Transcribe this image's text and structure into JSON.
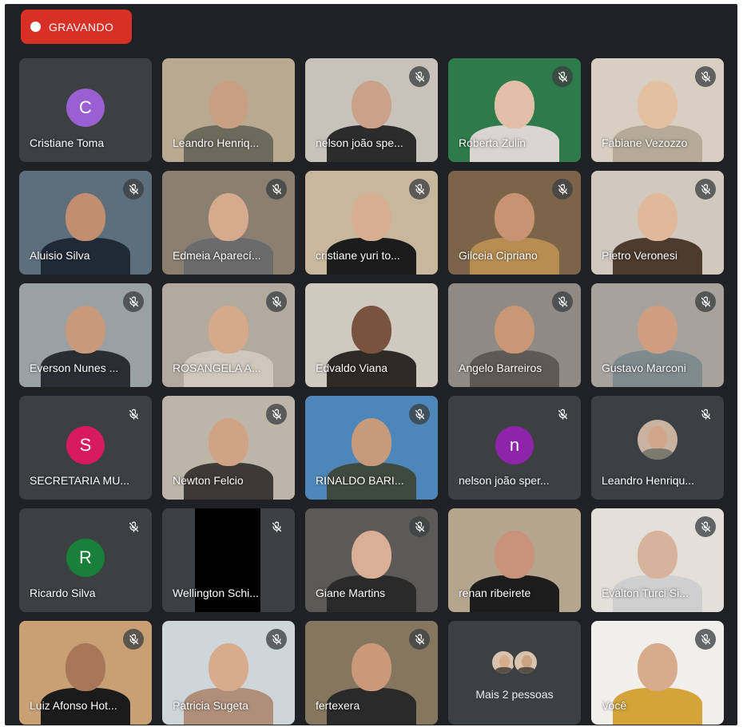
{
  "recording": {
    "label": "GRAVANDO",
    "color": "#d93025"
  },
  "colors": {
    "stage": "#202124",
    "tile": "#3c4043"
  },
  "tiles": [
    {
      "name": "Cristiane Toma",
      "type": "avatar",
      "letter": "C",
      "avatar_color": "#9a5fd1",
      "muted": false
    },
    {
      "name": "Leandro Henriq...",
      "type": "video",
      "muted": false,
      "bg": "#b9a991",
      "skin": "#c99f84",
      "shirt": "#6d6a5c"
    },
    {
      "name": "nelson joão spe...",
      "type": "video",
      "muted": true,
      "bg": "#c8c3ba",
      "skin": "#caa28a",
      "shirt": "#2c2c2c"
    },
    {
      "name": "Roberta Zulin",
      "type": "video",
      "muted": true,
      "bg": "#2e7a4a",
      "skin": "#e2bfa7",
      "shirt": "#d9d4cf"
    },
    {
      "name": "Fabiane Vezozzo",
      "type": "video",
      "muted": true,
      "bg": "#d8cfc2",
      "skin": "#e4c0a3",
      "shirt": "#b5aa98"
    },
    {
      "name": "Aluisio Silva",
      "type": "video",
      "muted": true,
      "bg": "#5d6e7d",
      "skin": "#c18f6f",
      "shirt": "#1f2a36"
    },
    {
      "name": "Edmeia Aparecí...",
      "type": "video",
      "muted": true,
      "bg": "#8a7f70",
      "skin": "#d5aa8d",
      "shirt": "#6b6b6b"
    },
    {
      "name": "cristiane yuri to...",
      "type": "video",
      "muted": true,
      "bg": "#c8b79c",
      "skin": "#d7ae91",
      "shirt": "#1c1c1c"
    },
    {
      "name": "Gilceia Cipriano",
      "type": "video",
      "muted": true,
      "bg": "#7c6448",
      "skin": "#c79373",
      "shirt": "#b88d52"
    },
    {
      "name": "Pietro Veronesi",
      "type": "video",
      "muted": true,
      "bg": "#d1c9bd",
      "skin": "#e0b89c",
      "shirt": "#4c3b2e"
    },
    {
      "name": "Everson Nunes ...",
      "type": "video",
      "muted": true,
      "bg": "#9aa1a5",
      "skin": "#c8997a",
      "shirt": "#2a2d33"
    },
    {
      "name": "ROSANGELA A...",
      "type": "video",
      "muted": true,
      "bg": "#b3aa9e",
      "skin": "#d6a98b",
      "shirt": "#cfc7bc"
    },
    {
      "name": "Edvaldo Viana",
      "type": "video",
      "muted": false,
      "bg": "#cfc9c0",
      "skin": "#7a5340",
      "shirt": "#2e2a26"
    },
    {
      "name": "Angelo Barreiros",
      "type": "video",
      "muted": true,
      "bg": "#8f8a83",
      "skin": "#c99676",
      "shirt": "#5d5a55"
    },
    {
      "name": "Gustavo Marconi",
      "type": "video",
      "muted": true,
      "bg": "#a7a39c",
      "skin": "#cf9e80",
      "shirt": "#7e8a8e"
    },
    {
      "name": "SECRETARIA MU...",
      "type": "avatar",
      "letter": "S",
      "avatar_color": "#d81b60",
      "muted": true
    },
    {
      "name": "Newton Felcio",
      "type": "video",
      "muted": true,
      "bg": "#bdb5a8",
      "skin": "#d0a286",
      "shirt": "#3d3a35"
    },
    {
      "name": "RINALDO BARI...",
      "type": "video",
      "muted": true,
      "bg": "#4d86b8",
      "skin": "#c79a7c",
      "shirt": "#3f4a3e"
    },
    {
      "name": "nelson joão sper...",
      "type": "avatar",
      "letter": "n",
      "avatar_color": "#8e24aa",
      "muted": true
    },
    {
      "name": "Leandro Henriqu...",
      "type": "photo-avatar",
      "muted": true,
      "skin": "#d2a68a",
      "shirt": "#7a7a6e"
    },
    {
      "name": "Ricardo Silva",
      "type": "avatar",
      "letter": "R",
      "avatar_color": "#188038",
      "muted": true
    },
    {
      "name": "Wellington Schi...",
      "type": "video",
      "muted": true,
      "bg": "#000000",
      "skin": "#000000",
      "shirt": "#000000",
      "dark": true
    },
    {
      "name": "Giane Martins",
      "type": "video",
      "muted": true,
      "bg": "#5c5a58",
      "skin": "#d9b096",
      "shirt": "#2a2a2a"
    },
    {
      "name": "renan ribeirete",
      "type": "video",
      "muted": false,
      "bg": "#b5a58e",
      "skin": "#c8937a",
      "shirt": "#1d1d1d"
    },
    {
      "name": "Evalton Turci Si...",
      "type": "video",
      "muted": true,
      "bg": "#e3e0da",
      "skin": "#d8b39b",
      "shirt": "#cfcfcf"
    },
    {
      "name": "Luiz Afonso Hot...",
      "type": "video",
      "muted": true,
      "bg": "#c9a074",
      "skin": "#a87658",
      "shirt": "#1b1b1b"
    },
    {
      "name": "Patricia Sugeta",
      "type": "video",
      "muted": true,
      "bg": "#cfd6da",
      "skin": "#d9ab8e",
      "shirt": "#b08f7a"
    },
    {
      "name": "fertexera",
      "type": "video",
      "muted": true,
      "bg": "#85765f",
      "skin": "#c9997a",
      "shirt": "#2a2a2a"
    },
    {
      "name": "",
      "type": "more",
      "label": "Mais 2 pessoas",
      "muted": false
    },
    {
      "name": "Você",
      "type": "video",
      "muted": true,
      "bg": "#f1efec",
      "skin": "#d7ab8d",
      "shirt": "#d4a43a"
    }
  ]
}
